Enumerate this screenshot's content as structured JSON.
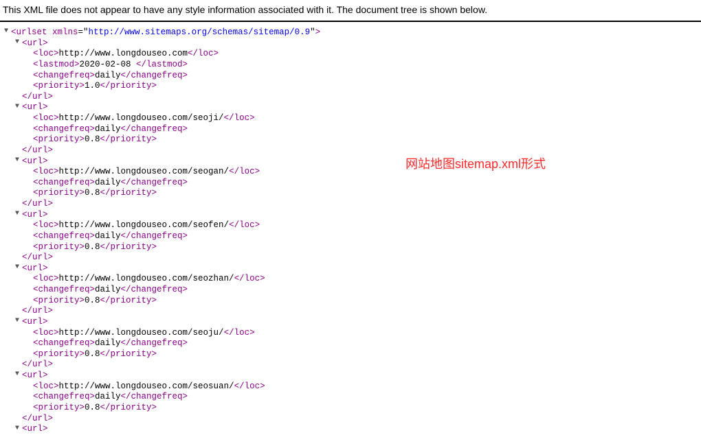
{
  "header_message": "This XML file does not appear to have any style information associated with it. The document tree is shown below.",
  "annotation": "网站地图sitemap.xml形式",
  "root": {
    "tag": "urlset",
    "attr_name": "xmlns",
    "attr_value": "http://www.sitemaps.org/schemas/sitemap/0.9"
  },
  "urls": [
    {
      "loc": "http://www.longdouseo.com",
      "lastmod": "2020-02-08 ",
      "changefreq": "daily",
      "priority": "1.0"
    },
    {
      "loc": "http://www.longdouseo.com/seoji/",
      "changefreq": "daily",
      "priority": "0.8"
    },
    {
      "loc": "http://www.longdouseo.com/seogan/",
      "changefreq": "daily",
      "priority": "0.8"
    },
    {
      "loc": "http://www.longdouseo.com/seofen/",
      "changefreq": "daily",
      "priority": "0.8"
    },
    {
      "loc": "http://www.longdouseo.com/seozhan/",
      "changefreq": "daily",
      "priority": "0.8"
    },
    {
      "loc": "http://www.longdouseo.com/seoju/",
      "changefreq": "daily",
      "priority": "0.8"
    },
    {
      "loc": "http://www.longdouseo.com/seosuan/",
      "changefreq": "daily",
      "priority": "0.8"
    }
  ],
  "glyphs": {
    "caret_down": "▼"
  }
}
